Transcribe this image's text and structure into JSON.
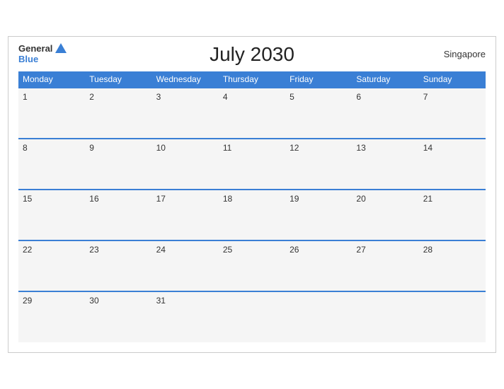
{
  "header": {
    "brand_general": "General",
    "brand_blue": "Blue",
    "title": "July 2030",
    "region": "Singapore"
  },
  "days_of_week": [
    "Monday",
    "Tuesday",
    "Wednesday",
    "Thursday",
    "Friday",
    "Saturday",
    "Sunday"
  ],
  "weeks": [
    [
      "1",
      "2",
      "3",
      "4",
      "5",
      "6",
      "7"
    ],
    [
      "8",
      "9",
      "10",
      "11",
      "12",
      "13",
      "14"
    ],
    [
      "15",
      "16",
      "17",
      "18",
      "19",
      "20",
      "21"
    ],
    [
      "22",
      "23",
      "24",
      "25",
      "26",
      "27",
      "28"
    ],
    [
      "29",
      "30",
      "31",
      "",
      "",
      "",
      ""
    ]
  ]
}
